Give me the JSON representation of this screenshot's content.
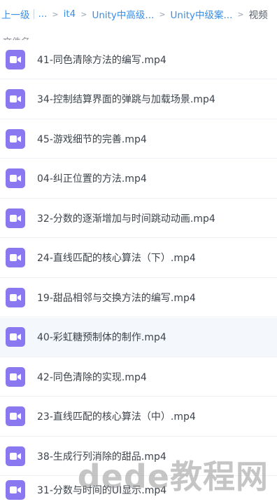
{
  "breadcrumb": {
    "back_label": "上一级",
    "ellipsis": "...",
    "items": [
      "it4",
      "Unity中高级...",
      "Unity中级案..."
    ],
    "current": "视频"
  },
  "header": {
    "column_name": "文件名"
  },
  "files": [
    {
      "name": "41-同色清除方法的编写.mp4"
    },
    {
      "name": "34-控制结算界面的弹跳与加载场景.mp4"
    },
    {
      "name": "45-游戏细节的完善.mp4"
    },
    {
      "name": "04-纠正位置的方法.mp4"
    },
    {
      "name": "32-分数的逐渐增加与时间跳动动画.mp4"
    },
    {
      "name": "24-直线匹配的核心算法（下）.mp4"
    },
    {
      "name": "19-甜品相邻与交换方法的编写.mp4"
    },
    {
      "name": "40-彩虹糖预制体的制作.mp4"
    },
    {
      "name": "42-同色清除的实现.mp4"
    },
    {
      "name": "23-直线匹配的核心算法（中）.mp4"
    },
    {
      "name": "38-生成行列消除的甜品.mp4"
    },
    {
      "name": "31-分数与时间的UI显示.mp4"
    }
  ],
  "icon": {
    "name": "video-file-icon",
    "color": "#8a78f0"
  },
  "watermark": "dede教程网"
}
